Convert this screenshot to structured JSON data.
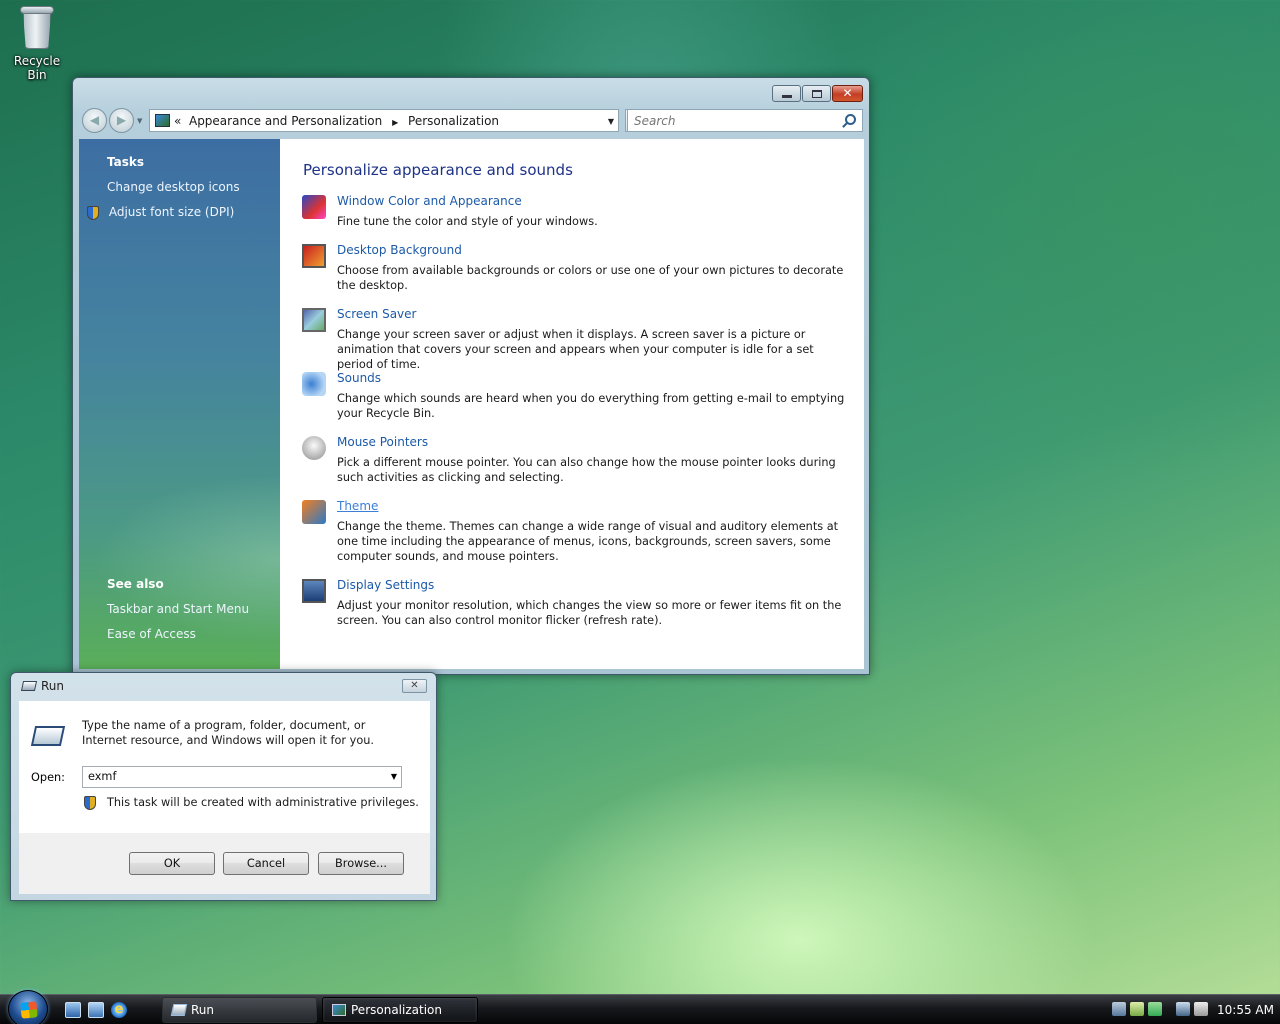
{
  "desktop": {
    "recycle_bin_label": "Recycle Bin"
  },
  "personalization_window": {
    "address_breadcrumb": [
      "Appearance and Personalization",
      "Personalization"
    ],
    "address_prefix": "«",
    "search_placeholder": "Search",
    "tasks": {
      "heading": "Tasks",
      "links": [
        "Change desktop icons",
        "Adjust font size (DPI)"
      ]
    },
    "see_also": {
      "heading": "See also",
      "links": [
        "Taskbar and Start Menu",
        "Ease of Access"
      ]
    },
    "content_title": "Personalize appearance and sounds",
    "items": [
      {
        "icon": "window-color-icon",
        "title": "Window Color and Appearance",
        "description": "Fine tune the color and style of your windows."
      },
      {
        "icon": "desktop-background-icon",
        "title": "Desktop Background",
        "description": "Choose from available backgrounds or colors or use one of your own pictures to decorate the desktop."
      },
      {
        "icon": "screen-saver-icon",
        "title": "Screen Saver",
        "description": "Change your screen saver or adjust when it displays. A screen saver is a picture or animation that covers your screen and appears when your computer is idle for a set period of time."
      },
      {
        "icon": "sounds-icon",
        "title": "Sounds",
        "description": "Change which sounds are heard when you do everything from getting e-mail to emptying your Recycle Bin."
      },
      {
        "icon": "mouse-pointers-icon",
        "title": "Mouse Pointers",
        "description": "Pick a different mouse pointer. You can also change how the mouse pointer looks during such activities as clicking and selecting."
      },
      {
        "icon": "theme-icon",
        "title": "Theme",
        "description": "Change the theme. Themes can change a wide range of visual and auditory elements at one time including the appearance of menus, icons, backgrounds, screen savers, some computer sounds, and mouse pointers."
      },
      {
        "icon": "display-settings-icon",
        "title": "Display Settings",
        "description": "Adjust your monitor resolution, which changes the view so more or fewer items fit on the screen. You can also control monitor flicker (refresh rate)."
      }
    ]
  },
  "run_dialog": {
    "title": "Run",
    "description": "Type the name of a program, folder, document, or Internet resource, and Windows will open it for you.",
    "open_label": "Open:",
    "open_value": "exmf",
    "admin_note": "This task will be created with administrative privileges.",
    "ok_label": "OK",
    "cancel_label": "Cancel",
    "browse_label": "Browse..."
  },
  "taskbar": {
    "buttons": [
      {
        "label": "Run"
      },
      {
        "label": "Personalization"
      }
    ],
    "clock": "10:55 AM"
  }
}
